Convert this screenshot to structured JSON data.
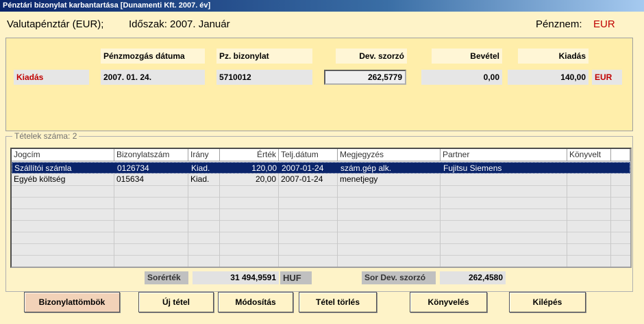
{
  "window": {
    "title": "Pénztári bizonylat karbantartása  [Dunamenti Kft.  2007. év]"
  },
  "header": {
    "account": "Valutapénztár (EUR);",
    "period": "Időszak: 2007.  Január",
    "currency_label": "Pénznem:",
    "currency_value": "EUR"
  },
  "voucher": {
    "labels": {
      "date": "Pénzmozgás dátuma",
      "number": "Pz. bizonylat",
      "rate": "Dev. szorzó",
      "income": "Bevétel",
      "expense": "Kiadás"
    },
    "type": "Kiadás",
    "date": "2007. 01. 24.",
    "number": "5710012",
    "rate": "262,5779",
    "income": "0,00",
    "expense": "140,00",
    "currency": "EUR"
  },
  "items": {
    "count_label": "Tételek száma: 2",
    "columns": [
      "Jogcím",
      "Bizonylatszám",
      "Irány",
      "Érték",
      "Telj.dátum",
      "Megjegyzés",
      "Partner",
      "Könyvelt"
    ],
    "rows": [
      [
        "Szállítói számla",
        "0126734",
        "Kiad.",
        "120,00",
        "2007-01-24",
        "szám.gép alk.",
        "Fujitsu Siemens",
        ""
      ],
      [
        "Egyéb költség",
        "015634",
        "Kiad.",
        "20,00",
        "2007-01-24",
        "menetjegy",
        "",
        ""
      ]
    ]
  },
  "summary": {
    "row_value_label": "Sorérték",
    "row_value": "31 494,9591",
    "row_value_currency": "HUF",
    "row_rate_label": "Sor Dev. szorzó",
    "row_rate": "262,4580"
  },
  "buttons": {
    "vouchers": "Bizonylattömbök",
    "new_item": "Új tétel",
    "modify": "Módosítás",
    "delete_item": "Tétel törlés",
    "post": "Könyvelés",
    "exit": "Kilépés"
  },
  "colors": {
    "accent_red": "#c00000",
    "selection": "#0a246a",
    "panel": "#ffeeaa"
  }
}
